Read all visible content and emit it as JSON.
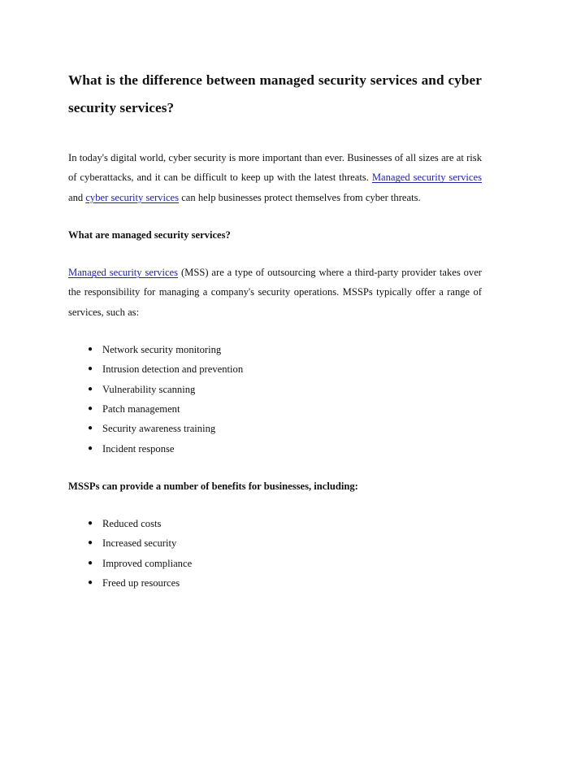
{
  "document": {
    "title_line_1": "What is the difference between managed security services",
    "title_line_2": "and cyber security services?",
    "title_full": "What is the difference between managed security services and cyber security services?"
  },
  "intro_paragraph": {
    "text_part_1": "In today's digital world, cyber security is more important than ever. Businesses of all sizes are at risk of cyberattacks, and it can be difficult to keep up with the latest threats. ",
    "link_1": "Managed security services",
    "text_part_2": " and ",
    "link_2": "cyber security services",
    "text_part_3": " can help businesses protect themselves from cyber threats."
  },
  "section_mss": {
    "heading": "What are managed security services?",
    "paragraph_link": "Managed security services",
    "paragraph_rest": " (MSS) are a type of outsourcing where a third-party provider takes over the responsibility for managing a company's security operations. MSSPs typically offer a range of services, such as:",
    "services_list": [
      "Network security monitoring",
      "Intrusion detection and prevention",
      "Vulnerability scanning",
      "Patch management",
      "Security awareness training",
      "Incident response"
    ]
  },
  "section_benefits": {
    "heading": "MSSPs can provide a number of benefits for businesses, including:",
    "benefits_list": [
      "Reduced costs",
      "Increased security",
      "Improved compliance",
      "Freed up resources"
    ]
  },
  "style": {
    "link_color": "#2222a8",
    "text_color": "#111111",
    "background_color": "#ffffff",
    "bullet_glyph": "●"
  }
}
